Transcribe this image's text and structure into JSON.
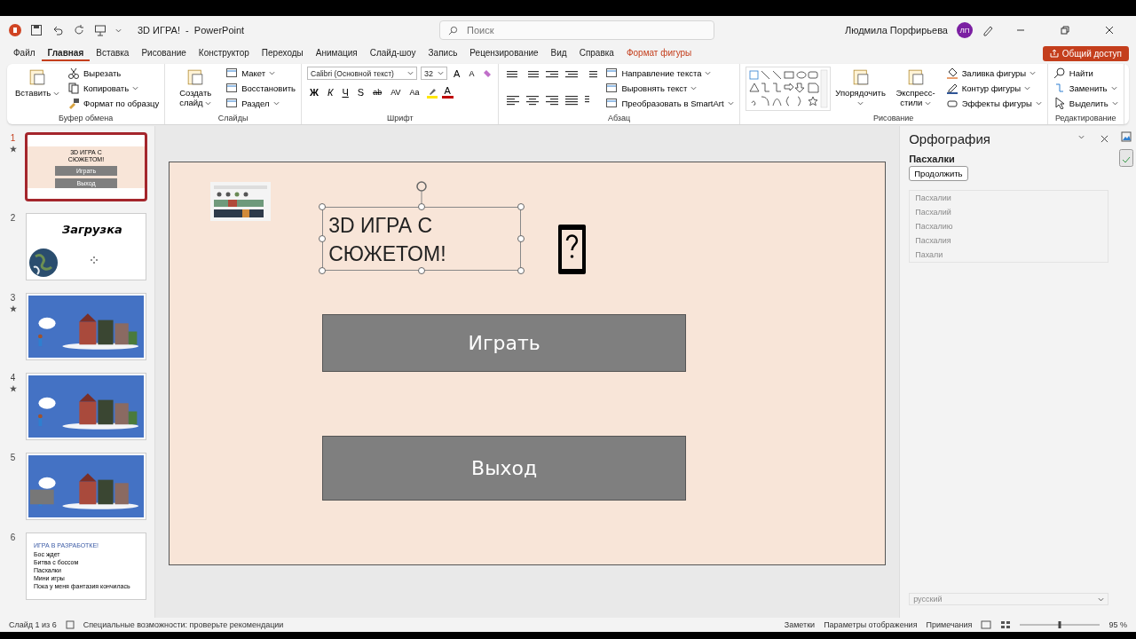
{
  "window": {
    "title": "3D ИГРА!  -  PowerPoint",
    "search_placeholder": "Поиск",
    "user": "Людмила Порфирьева",
    "avatar": "ЛП"
  },
  "tabs": [
    {
      "label": "Файл",
      "selected": false,
      "kind": "normal"
    },
    {
      "label": "Главная",
      "selected": true,
      "kind": "normal"
    },
    {
      "label": "Вставка",
      "selected": false,
      "kind": "normal"
    },
    {
      "label": "Рисование",
      "selected": false,
      "kind": "normal"
    },
    {
      "label": "Конструктор",
      "selected": false,
      "kind": "normal"
    },
    {
      "label": "Переходы",
      "selected": false,
      "kind": "normal"
    },
    {
      "label": "Анимация",
      "selected": false,
      "kind": "normal"
    },
    {
      "label": "Слайд-шоу",
      "selected": false,
      "kind": "normal"
    },
    {
      "label": "Запись",
      "selected": false,
      "kind": "normal"
    },
    {
      "label": "Рецензирование",
      "selected": false,
      "kind": "normal"
    },
    {
      "label": "Вид",
      "selected": false,
      "kind": "normal"
    },
    {
      "label": "Справка",
      "selected": false,
      "kind": "normal"
    },
    {
      "label": "Формат фигуры",
      "selected": false,
      "kind": "contextual"
    }
  ],
  "share_button": "Общий доступ",
  "ribbon": [
    {
      "label": "Буфер обмена",
      "items": [
        {
          "kind": "big",
          "label": "Вставить",
          "dropdown": true
        },
        {
          "kind": "stack",
          "items": [
            {
              "label": "Вырезать",
              "dropdown": false
            },
            {
              "label": "Копировать",
              "dropdown": true
            },
            {
              "label": "Формат по образцу",
              "dropdown": false
            }
          ]
        }
      ]
    },
    {
      "label": "Слайды",
      "items": [
        {
          "kind": "big",
          "label": "Создать слайд",
          "dropdown": true
        },
        {
          "kind": "stack",
          "items": [
            {
              "label": "Макет",
              "dropdown": true
            },
            {
              "label": "Восстановить",
              "dropdown": false
            },
            {
              "label": "Раздел",
              "dropdown": true
            }
          ]
        }
      ]
    },
    {
      "label": "Шрифт",
      "items": [
        {
          "kind": "font",
          "font": "Calibri (Основной текст)",
          "size": "32",
          "size_buttons": [
            "A",
            "A"
          ],
          "formats": [
            "Ж",
            "К",
            "Ч",
            "S",
            "ab",
            "AV",
            "Aa"
          ],
          "color_buttons": [
            "A"
          ]
        }
      ]
    },
    {
      "label": "Абзац",
      "items": [
        {
          "kind": "paragraph"
        },
        {
          "kind": "stack",
          "items": [
            {
              "label": "Направление текста",
              "dropdown": true
            },
            {
              "label": "Выровнять текст",
              "dropdown": true
            },
            {
              "label": "Преобразовать в SmartArt",
              "dropdown": true
            }
          ]
        }
      ]
    },
    {
      "label": "Рисование",
      "items": [
        {
          "kind": "gallery"
        },
        {
          "kind": "big",
          "label": "Упорядочить",
          "dropdown": true
        },
        {
          "kind": "big",
          "label": "Экспресс-стили",
          "dropdown": true
        },
        {
          "kind": "stack",
          "items": [
            {
              "label": "Заливка фигуры",
              "dropdown": true
            },
            {
              "label": "Контур фигуры",
              "dropdown": true
            },
            {
              "label": "Эффекты фигуры",
              "dropdown": true
            }
          ]
        }
      ]
    },
    {
      "label": "Редактирование",
      "items": [
        {
          "kind": "stack",
          "items": [
            {
              "label": "Найти",
              "dropdown": false
            },
            {
              "label": "Заменить",
              "dropdown": true
            },
            {
              "label": "Выделить",
              "dropdown": true
            }
          ]
        }
      ]
    }
  ],
  "slides": [
    {
      "number": "1",
      "selected": true,
      "animated": true,
      "kind": "title",
      "title": "3D ИГРА С СЮЖЕТОМ!",
      "buttons": [
        "Играть",
        "Выход"
      ]
    },
    {
      "number": "2",
      "selected": false,
      "animated": false,
      "kind": "loading",
      "title": "Загрузка"
    },
    {
      "number": "3",
      "selected": false,
      "animated": true,
      "kind": "scene"
    },
    {
      "number": "4",
      "selected": false,
      "animated": true,
      "kind": "scene"
    },
    {
      "number": "5",
      "selected": false,
      "animated": false,
      "kind": "scene"
    },
    {
      "number": "6",
      "selected": false,
      "animated": false,
      "kind": "text",
      "title": "ИГРА В РАЗРАБОТКЕ!",
      "lines": [
        "Бос ждет",
        "Битва с боссом",
        "Пасхалки",
        "Мини игры",
        "Пока у меня фантазия кончилась"
      ]
    }
  ],
  "slide": {
    "title": "3D ИГРА С СЮЖЕТОМ!",
    "buttons": [
      "Играть",
      "Выход"
    ]
  },
  "spelling": {
    "title": "Орфография",
    "word": "Пасхалки",
    "continue": "Продолжить",
    "suggestions": [
      "Пасхалии",
      "Пасхалий",
      "Пасхалию",
      "Пасхалия",
      "Пахали"
    ],
    "language": "русский"
  },
  "status_bar": {
    "slide": "Слайд 1 из 6",
    "accessibility": "Специальные возможности: проверьте рекомендации",
    "notes": "Заметки",
    "display": "Параметры отображения",
    "comments": "Примечания",
    "zoom": "95 %",
    "zoom_slider": {
      "level": 0.5
    }
  }
}
